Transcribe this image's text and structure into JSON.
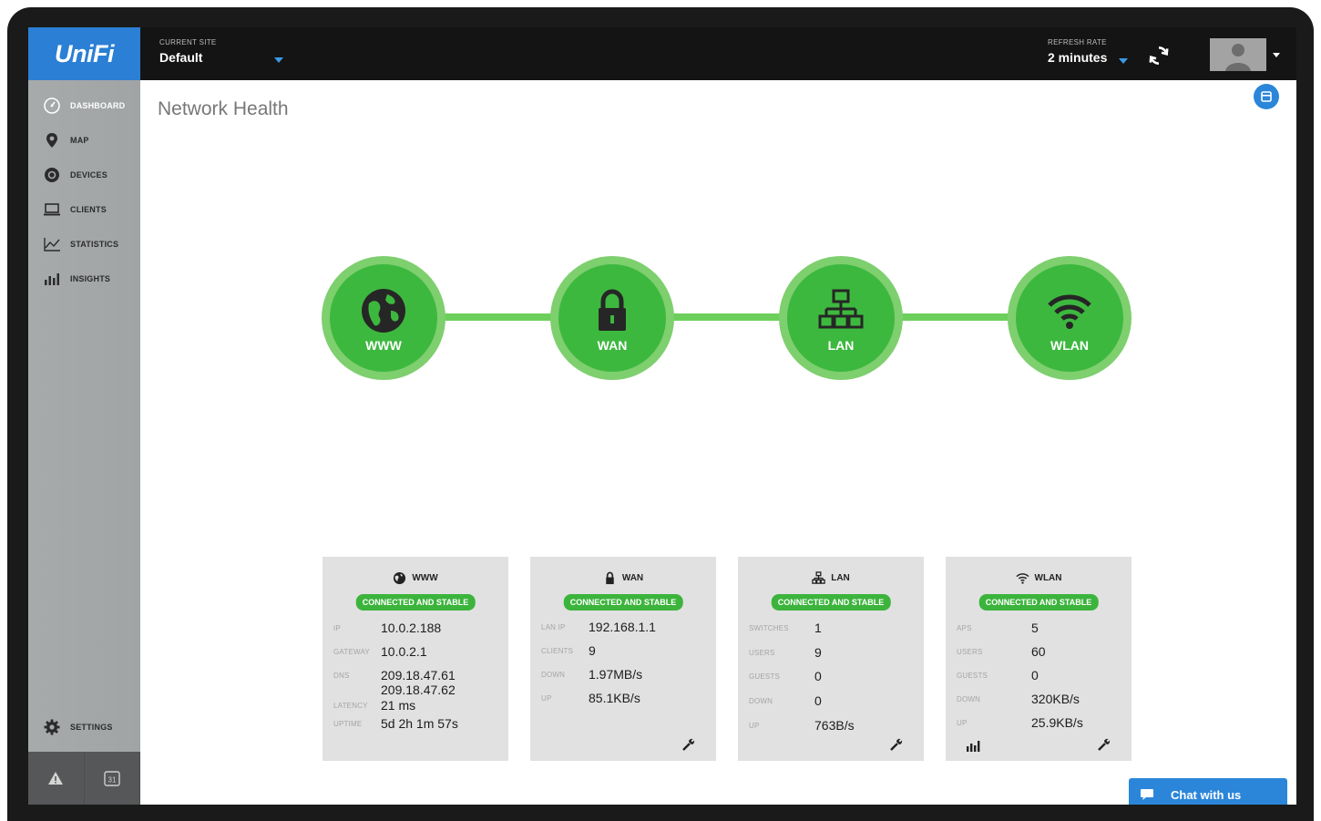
{
  "app": {
    "logo_text": "UniFi",
    "brand_color": "#2b7fd4",
    "accent_color": "#3db83f"
  },
  "header": {
    "site_label": "CURRENT SITE",
    "site_value": "Default",
    "refresh_label": "REFRESH RATE",
    "refresh_value": "2 minutes"
  },
  "sidebar": {
    "items": [
      {
        "label": "DASHBOARD",
        "icon": "dashboard-icon",
        "active": true
      },
      {
        "label": "MAP",
        "icon": "map-pin-icon"
      },
      {
        "label": "DEVICES",
        "icon": "devices-icon"
      },
      {
        "label": "CLIENTS",
        "icon": "laptop-icon"
      },
      {
        "label": "STATISTICS",
        "icon": "line-chart-icon"
      },
      {
        "label": "INSIGHTS",
        "icon": "bar-chart-icon"
      }
    ],
    "settings_label": "SETTINGS",
    "calendar_day": "31"
  },
  "main": {
    "title": "Network Health",
    "nodes": [
      {
        "label": "WWW",
        "icon": "globe-icon"
      },
      {
        "label": "WAN",
        "icon": "lock-icon"
      },
      {
        "label": "LAN",
        "icon": "network-icon"
      },
      {
        "label": "WLAN",
        "icon": "wifi-icon"
      }
    ]
  },
  "cards": {
    "www": {
      "title": "WWW",
      "status": "CONNECTED AND STABLE",
      "ip_label": "IP",
      "ip": "10.0.2.188",
      "gateway_label": "GATEWAY",
      "gateway": "10.0.2.1",
      "dns_label": "DNS",
      "dns1": "209.18.47.61",
      "dns2": "209.18.47.62",
      "latency_label": "LATENCY",
      "latency": "21 ms",
      "uptime_label": "UPTIME",
      "uptime": "5d 2h 1m 57s"
    },
    "wan": {
      "title": "WAN",
      "status": "CONNECTED AND STABLE",
      "lanip_label": "LAN IP",
      "lanip": "192.168.1.1",
      "clients_label": "CLIENTS",
      "clients": "9",
      "down_label": "DOWN",
      "down": "1.97MB/s",
      "up_label": "UP",
      "up": "85.1KB/s"
    },
    "lan": {
      "title": "LAN",
      "status": "CONNECTED AND STABLE",
      "switches_label": "SWITCHES",
      "switches": "1",
      "users_label": "USERS",
      "users": "9",
      "guests_label": "GUESTS",
      "guests": "0",
      "down_label": "DOWN",
      "down": "0",
      "up_label": "UP",
      "up": "763B/s"
    },
    "wlan": {
      "title": "WLAN",
      "status": "CONNECTED AND STABLE",
      "aps_label": "APS",
      "aps": "5",
      "users_label": "USERS",
      "users": "60",
      "guests_label": "GUESTS",
      "guests": "0",
      "down_label": "DOWN",
      "down": "320KB/s",
      "up_label": "UP",
      "up": "25.9KB/s"
    }
  },
  "chat": {
    "label": "Chat with us"
  }
}
